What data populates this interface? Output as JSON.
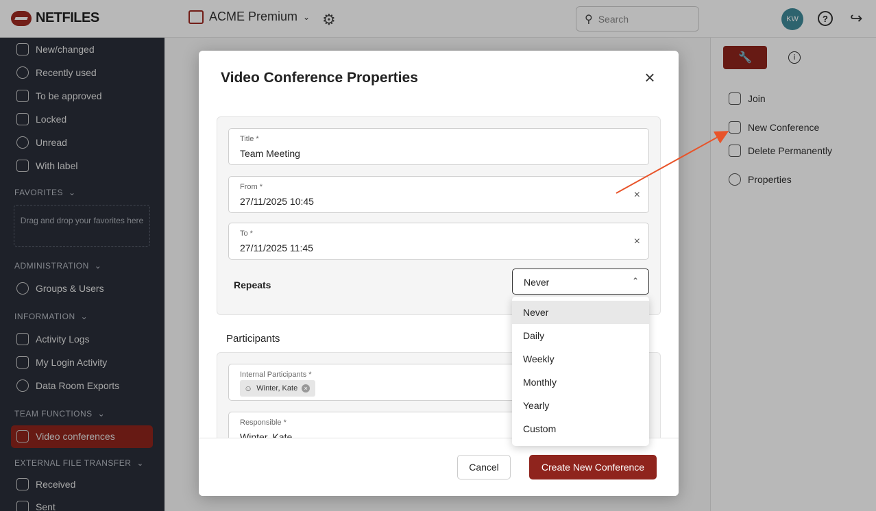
{
  "topbar": {
    "logo": "NETFILES",
    "room": "ACME Premium",
    "search_placeholder": "Search",
    "avatar_initials": "KW",
    "help": "?"
  },
  "sidebar": {
    "items": [
      {
        "label": "New/changed"
      },
      {
        "label": "Recently used"
      },
      {
        "label": "To be approved"
      },
      {
        "label": "Locked"
      },
      {
        "label": "Unread"
      },
      {
        "label": "With label"
      }
    ],
    "favorites_head": "FAVORITES",
    "favorites_drop": "Drag and drop your favorites here",
    "administration_head": "ADMINISTRATION",
    "admin_items": [
      {
        "label": "Groups & Users"
      }
    ],
    "information_head": "INFORMATION",
    "info_items": [
      {
        "label": "Activity Logs"
      },
      {
        "label": "My Login Activity"
      },
      {
        "label": "Data Room Exports"
      }
    ],
    "team_head": "TEAM FUNCTIONS",
    "team_items": [
      {
        "label": "Video conferences"
      }
    ],
    "external_head": "EXTERNAL FILE TRANSFER",
    "external_items": [
      {
        "label": "Received"
      },
      {
        "label": "Sent"
      }
    ]
  },
  "right_panel": {
    "join": "Join",
    "new_conference": "New Conference",
    "delete_permanently": "Delete Permanently",
    "properties": "Properties"
  },
  "modal": {
    "title": "Video Conference Properties",
    "title_field": {
      "label": "Title *",
      "value": "Team Meeting"
    },
    "from_field": {
      "label": "From *",
      "value": "27/11/2025 10:45"
    },
    "to_field": {
      "label": "To *",
      "value": "27/11/2025 11:45"
    },
    "repeats_label": "Repeats",
    "repeats_value": "Never",
    "participants_title": "Participants",
    "internal_label": "Internal Participants *",
    "internal_chip": "Winter, Kate",
    "responsible_label": "Responsible *",
    "responsible_value": "Winter, Kate",
    "cancel": "Cancel",
    "create": "Create New Conference"
  },
  "dropdown": {
    "options": [
      "Never",
      "Daily",
      "Weekly",
      "Monthly",
      "Yearly",
      "Custom"
    ],
    "selected": "Never"
  },
  "colors": {
    "accent": "#8f241d",
    "sidebar_bg": "#2a2f3a",
    "arrow": "#e8542a"
  }
}
